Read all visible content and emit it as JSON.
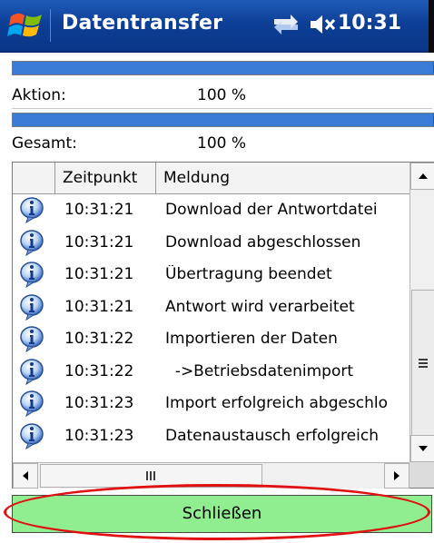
{
  "window": {
    "title": "Datentransfer",
    "clock": "10:31",
    "icons": [
      "windows-start-icon",
      "connectivity-icon",
      "volume-muted-icon"
    ]
  },
  "progress": {
    "action": {
      "label": "Aktion:",
      "value_text": "100 %",
      "fraction": 1.0
    },
    "total": {
      "label": "Gesamt:",
      "value_text": "100 %",
      "fraction": 1.0
    }
  },
  "log": {
    "columns": [
      "",
      "Zeitpunkt",
      "Meldung"
    ],
    "rows": [
      {
        "icon": "info-icon",
        "time": "10:31:21",
        "message": "Download der Antwortdatei"
      },
      {
        "icon": "info-icon",
        "time": "10:31:21",
        "message": "Download abgeschlossen"
      },
      {
        "icon": "info-icon",
        "time": "10:31:21",
        "message": "Übertragung beendet"
      },
      {
        "icon": "info-icon",
        "time": "10:31:21",
        "message": "Antwort wird verarbeitet"
      },
      {
        "icon": "info-icon",
        "time": "10:31:22",
        "message": "Importieren der Daten"
      },
      {
        "icon": "info-icon",
        "time": "10:31:22",
        "message": "  ->Betriebsdatenimport"
      },
      {
        "icon": "info-icon",
        "time": "10:31:23",
        "message": "Import erfolgreich abgeschlo"
      },
      {
        "icon": "info-icon",
        "time": "10:31:23",
        "message": "Datenaustausch erfolgreich"
      }
    ],
    "vscroll_position": 0.5,
    "hscroll_position": 0.0
  },
  "close_button": {
    "label": "Schließen"
  },
  "accent": {
    "highlight_ring": "#e01010",
    "button_bg": "#90ee90",
    "progress": "#3a7bd5"
  }
}
